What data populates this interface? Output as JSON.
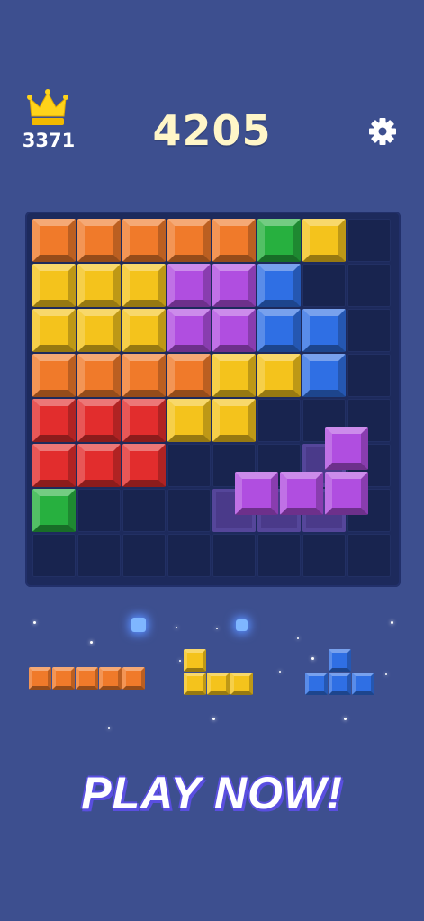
{
  "header": {
    "best_score": "3371",
    "score": "4205"
  },
  "icons": {
    "crown": "crown-icon",
    "settings": "gear-icon"
  },
  "colors": {
    "background": "#3d4f8f",
    "board": "#1d2a5c",
    "orange": "#f07a2a",
    "green": "#27b03f",
    "yellow": "#f4c31c",
    "purple": "#b04ee0",
    "blue": "#2f6fe4",
    "red": "#e22d2d",
    "ghost": "#4a3a8a"
  },
  "board": {
    "rows": [
      [
        "orange",
        "orange",
        "orange",
        "orange",
        "orange",
        "green",
        "yellow",
        ""
      ],
      [
        "yellow",
        "yellow",
        "yellow",
        "purple",
        "purple",
        "blue",
        "",
        ""
      ],
      [
        "yellow",
        "yellow",
        "yellow",
        "purple",
        "purple",
        "blue",
        "blue",
        ""
      ],
      [
        "orange",
        "orange",
        "orange",
        "orange",
        "yellow",
        "yellow",
        "blue",
        ""
      ],
      [
        "red",
        "red",
        "red",
        "yellow",
        "yellow",
        "",
        "",
        ""
      ],
      [
        "red",
        "red",
        "red",
        "",
        "",
        "",
        "ghost",
        ""
      ],
      [
        "green",
        "",
        "",
        "",
        "ghost",
        "ghost",
        "ghost",
        ""
      ],
      [
        "",
        "",
        "",
        "",
        "",
        "",
        "",
        ""
      ]
    ],
    "dragging_piece": {
      "color": "purple",
      "cells": [
        [
          0,
          2
        ],
        [
          1,
          0
        ],
        [
          1,
          1
        ],
        [
          1,
          2
        ]
      ]
    }
  },
  "tray": {
    "pieces": [
      {
        "name": "orange-line-piece",
        "color": "orange",
        "cells": [
          [
            0,
            0
          ],
          [
            0,
            1
          ],
          [
            0,
            2
          ],
          [
            0,
            3
          ],
          [
            0,
            4
          ]
        ]
      },
      {
        "name": "yellow-l-piece",
        "color": "yellow",
        "cells": [
          [
            0,
            0
          ],
          [
            1,
            0
          ],
          [
            1,
            1
          ],
          [
            1,
            2
          ]
        ]
      },
      {
        "name": "blue-t-piece",
        "color": "blue",
        "cells": [
          [
            0,
            1
          ],
          [
            1,
            0
          ],
          [
            1,
            1
          ],
          [
            1,
            2
          ]
        ]
      }
    ]
  },
  "cta": {
    "label": "PLAY NOW!"
  }
}
